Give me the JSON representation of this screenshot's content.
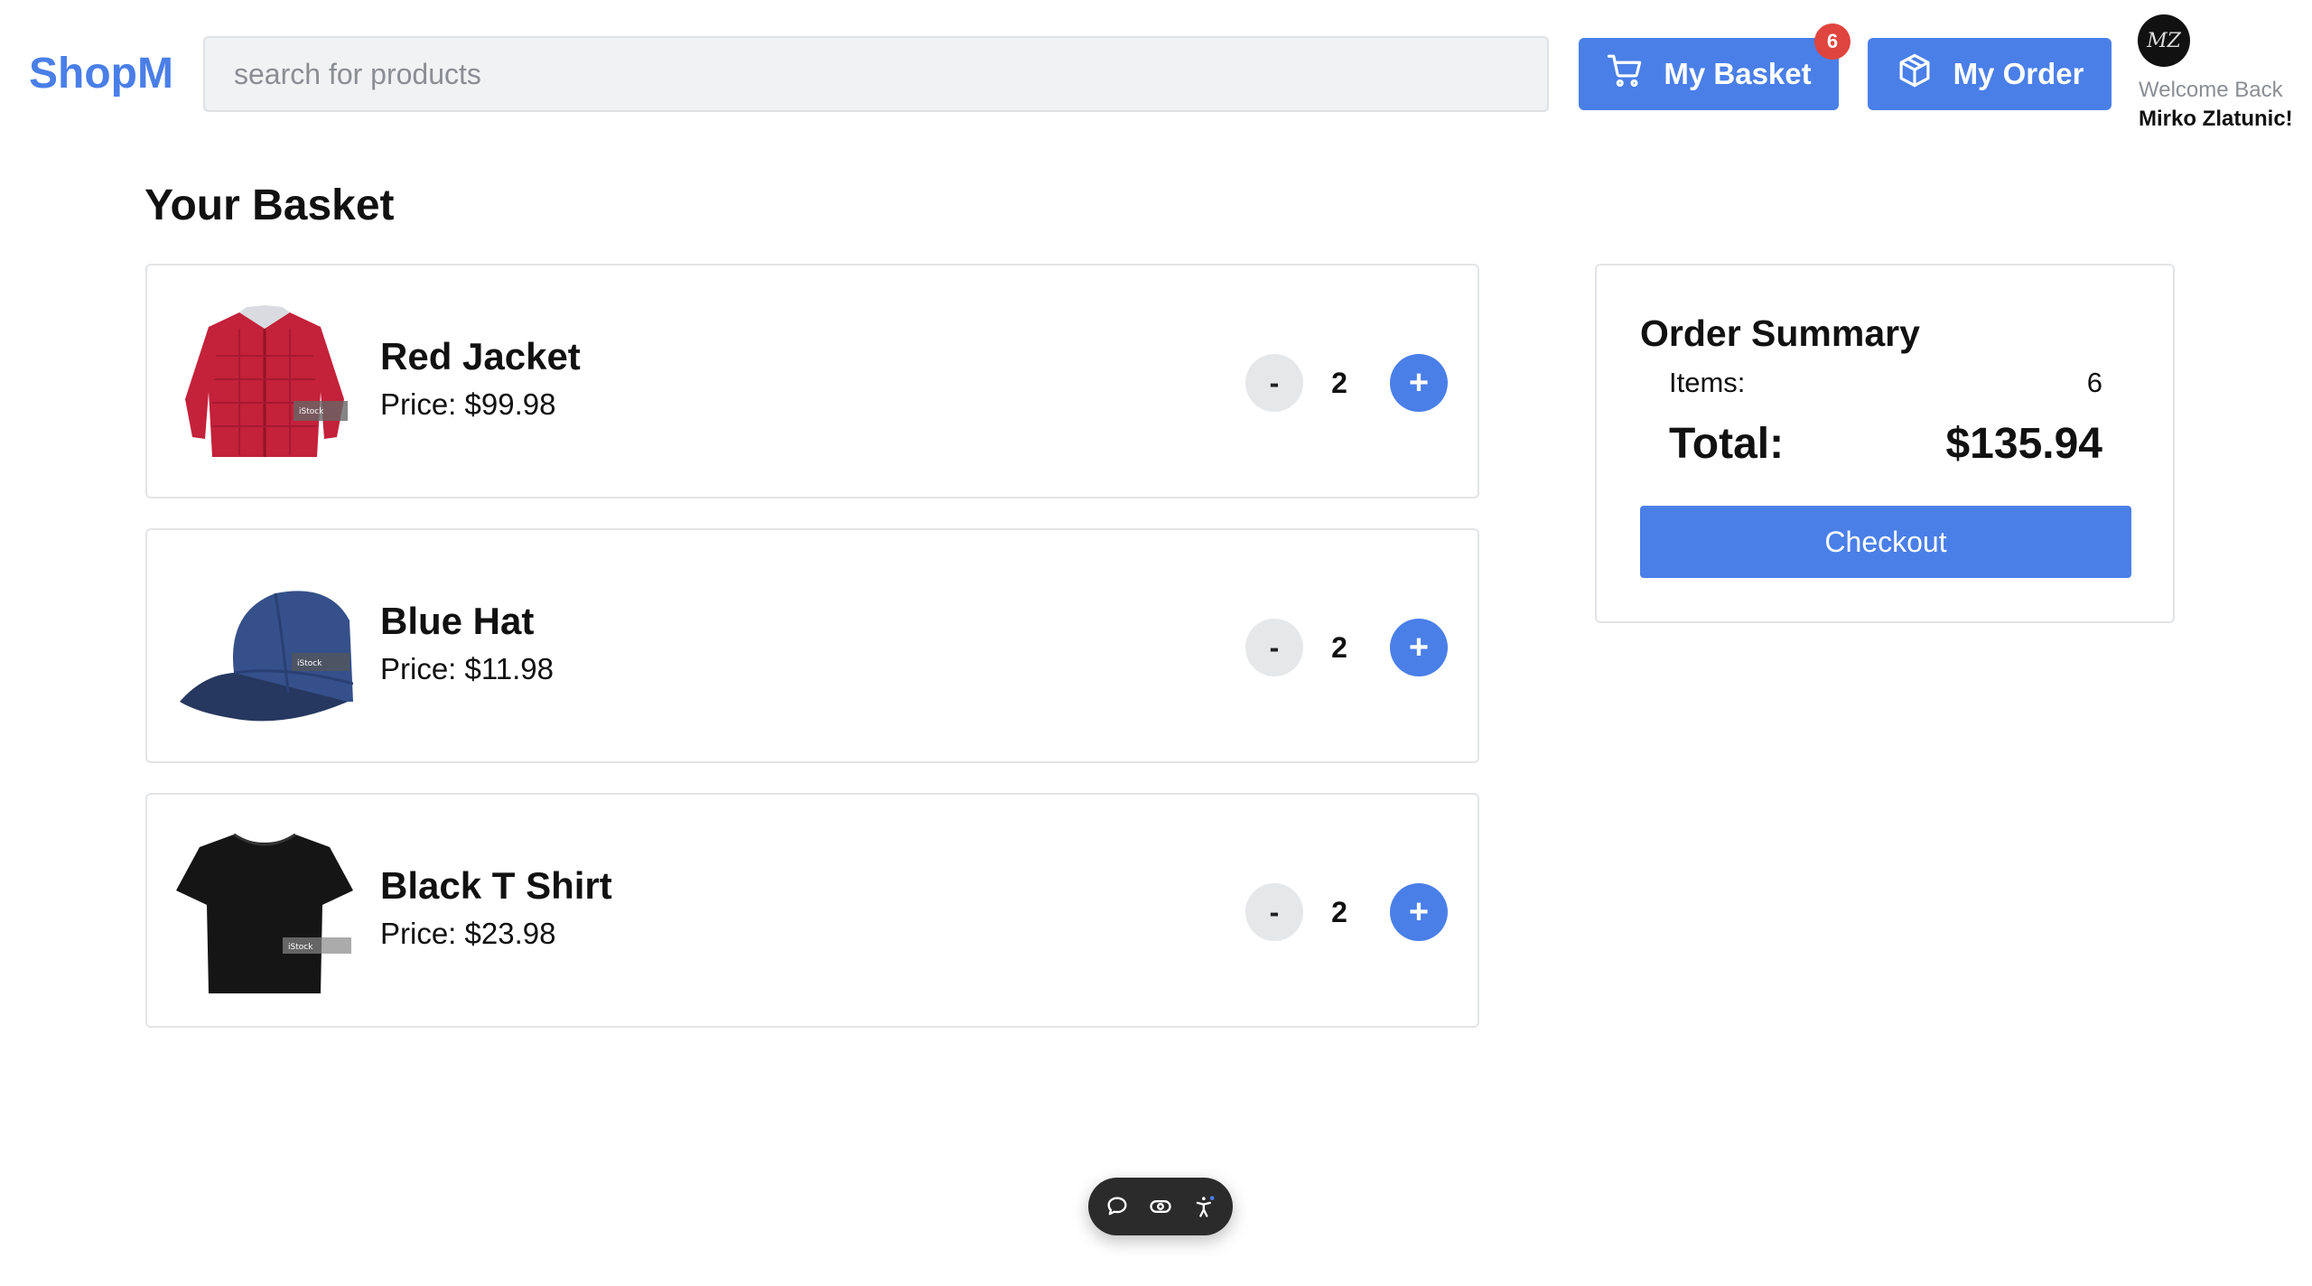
{
  "header": {
    "logo": "ShopM",
    "search": {
      "placeholder": "search for products",
      "value": ""
    },
    "basket_button": {
      "label": "My Basket",
      "icon": "cart-icon",
      "badge": "6"
    },
    "order_button": {
      "label": "My Order",
      "icon": "package-icon"
    },
    "user": {
      "greeting": "Welcome Back",
      "name": "Mirko Zlatunic!",
      "avatar_initials": "MZ"
    }
  },
  "basket": {
    "title": "Your Basket",
    "items": [
      {
        "name": "Red Jacket",
        "price": "Price: $99.98",
        "quantity": "2",
        "image": "red-jacket"
      },
      {
        "name": "Blue Hat",
        "price": "Price: $11.98",
        "quantity": "2",
        "image": "blue-hat"
      },
      {
        "name": "Black T Shirt",
        "price": "Price: $23.98",
        "quantity": "2",
        "image": "black-tshirt"
      }
    ],
    "minus_label": "-",
    "plus_label": "+"
  },
  "summary": {
    "title": "Order Summary",
    "items_label": "Items:",
    "items_value": "6",
    "total_label": "Total:",
    "total_value": "$135.94",
    "checkout_label": "Checkout"
  },
  "toolbar": {
    "icons": [
      "chat-icon",
      "eye-icon",
      "accessibility-icon"
    ]
  },
  "colors": {
    "accent": "#4a7fe8",
    "badge": "#e0443e"
  }
}
